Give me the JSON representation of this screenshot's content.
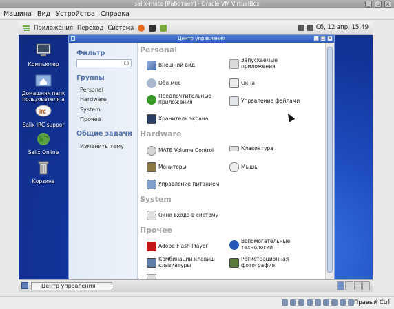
{
  "host": {
    "title": "salix-mate [Работает] - Oracle VM VirtualBox",
    "menu": [
      "Машина",
      "Вид",
      "Устройства",
      "Справка"
    ],
    "status_right": "Правый Ctrl"
  },
  "guest_panel": {
    "apps": "Приложения",
    "places": "Переход",
    "system": "Система",
    "clock": "Сб, 12 апр, 15:49"
  },
  "desktop_icons": [
    {
      "label": "Компьютер"
    },
    {
      "label": "Домашняя папк пользователя a"
    },
    {
      "label": "Salix IRC suppor"
    },
    {
      "label": "Salix Online"
    },
    {
      "label": "Корзина"
    }
  ],
  "cc": {
    "title": "Центр управления",
    "side": {
      "filter": "Фильтр",
      "groups": "Группы",
      "groups_items": [
        "Personal",
        "Hardware",
        "System",
        "Прочее"
      ],
      "common": "Общие задачи",
      "common_items": [
        "Изменить тему"
      ]
    },
    "sections": {
      "personal": "Personal",
      "hardware": "Hardware",
      "system": "System",
      "other": "Прочее"
    },
    "items": {
      "appearance": "Внешний вид",
      "startup": "Запускаемые\nприложения",
      "about": "Обо мне",
      "windows": "Окна",
      "preferred": "Предпочтительные\nприложения",
      "filemgmt": "Управление файлами",
      "screensaver": "Хранитель экрана",
      "volume": "MATE Volume Control",
      "keyboard": "Клавиатура",
      "monitors": "Мониторы",
      "mouse": "Мышь",
      "power": "Управление питанием",
      "login": "Окно входа в систему",
      "flash": "Adobe Flash Player",
      "assistive": "Вспомогательные\nтехнологии",
      "shortcuts": "Комбинации клавиш\nклавиатуры",
      "register": "Регистрационная\nфотография"
    }
  },
  "taskbar": {
    "task": "Центр управления"
  }
}
